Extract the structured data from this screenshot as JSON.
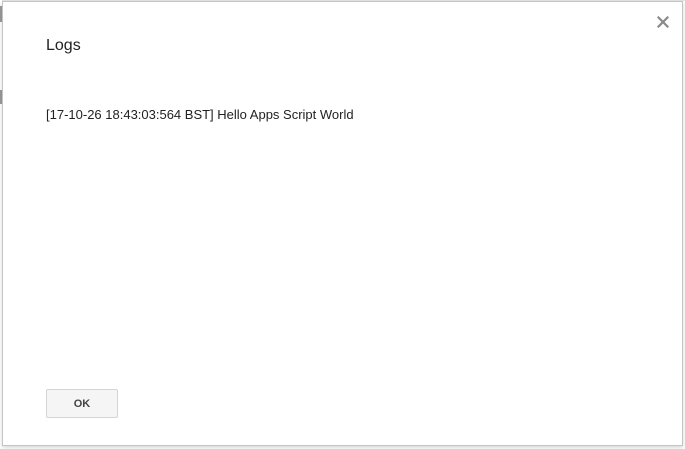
{
  "dialog": {
    "title": "Logs",
    "close_icon": "close-icon",
    "log_entries": [
      "[17-10-26 18:43:03:564 BST] Hello Apps Script World"
    ],
    "ok_label": "OK"
  },
  "colors": {
    "title_text": "#222222",
    "close_icon": "#8a8a8a",
    "button_bg": "#f5f5f5",
    "button_border": "#d4d4d4",
    "dialog_border": "#c4c4c4"
  }
}
